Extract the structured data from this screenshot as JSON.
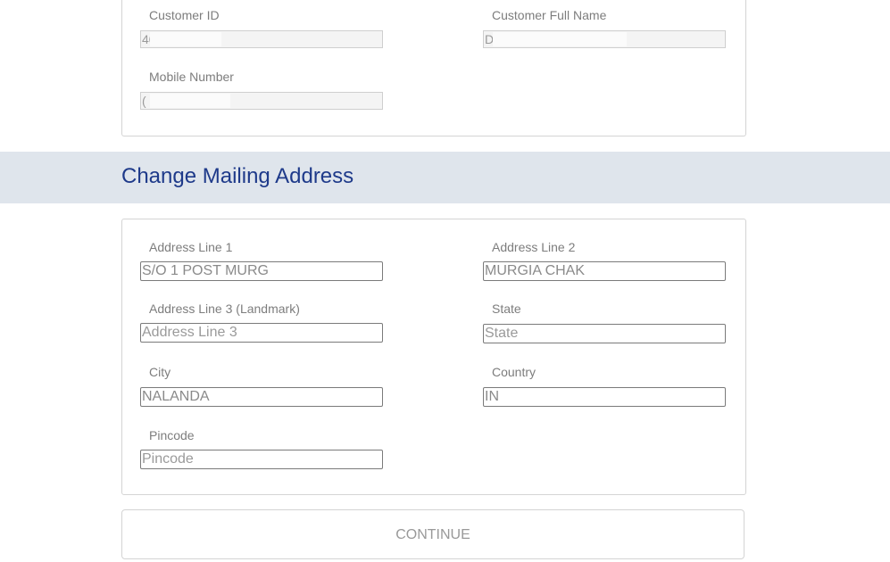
{
  "customer_info": {
    "customer_id": {
      "label": "Customer ID",
      "value": "40"
    },
    "customer_full_name": {
      "label": "Customer Full Name",
      "value": "D"
    },
    "mobile_number": {
      "label": "Mobile Number",
      "value": "("
    }
  },
  "section": {
    "title": "Change Mailing Address",
    "banner_color": "#dfe5ec",
    "title_color": "#1e3a8a"
  },
  "address": {
    "line1": {
      "label": "Address Line 1",
      "value": "S/O                     1 POST MURG"
    },
    "line2": {
      "label": "Address Line 2",
      "value": "MURGIA CHAK"
    },
    "line3": {
      "label": "Address Line 3 (Landmark)",
      "value": "",
      "placeholder": "Address Line 3"
    },
    "state": {
      "label": "State",
      "value": "",
      "placeholder": "State"
    },
    "city": {
      "label": "City",
      "value": "NALANDA"
    },
    "country": {
      "label": "Country",
      "value": "IN"
    },
    "pincode": {
      "label": "Pincode",
      "value": "",
      "placeholder": "Pincode"
    }
  },
  "actions": {
    "continue_label": "CONTINUE"
  }
}
